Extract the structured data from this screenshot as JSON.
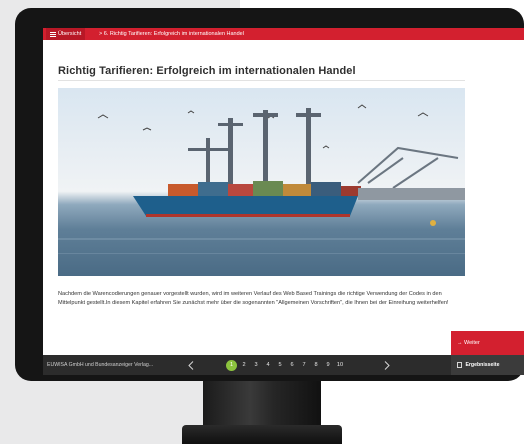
{
  "topbar": {
    "menu_label": "Übersicht",
    "breadcrumb": "> 6. Richtig Tarifieren: Erfolgreich im internationalen Handel"
  },
  "page": {
    "title": "Richtig Tarifieren: Erfolgreich im internationalen Handel",
    "paragraph": "Nachdem die Warencodierungen genauer vorgestellt wurden, wird im weiteren Verlauf des Web Based Trainings die richtige Verwendung der Codes in den Mittelpunkt gestellt.In diesem Kapitel erfahren Sie zunächst mehr über die sogenannten \"Allgemeinen Vorschriften\", die Ihnen bei der Einreihung weiterhelfen!"
  },
  "actions": {
    "weiter_label": "→ Weiter"
  },
  "footer": {
    "copyright": "EUWISA GmbH und Bundesanzeiger Verlag...",
    "pages": [
      "1",
      "2",
      "3",
      "4",
      "5",
      "6",
      "7",
      "8",
      "9",
      "10"
    ],
    "active_page": "1",
    "ergebnis_label": "Ergebnisseite"
  },
  "colors": {
    "brand_red": "#d3202f",
    "active_page_green": "#8cc33e",
    "footer_bg": "#2c2c2c"
  },
  "icons": {
    "menu": "hamburger-icon",
    "prev": "chevron-left-icon",
    "next": "chevron-right-icon",
    "result": "document-icon"
  }
}
